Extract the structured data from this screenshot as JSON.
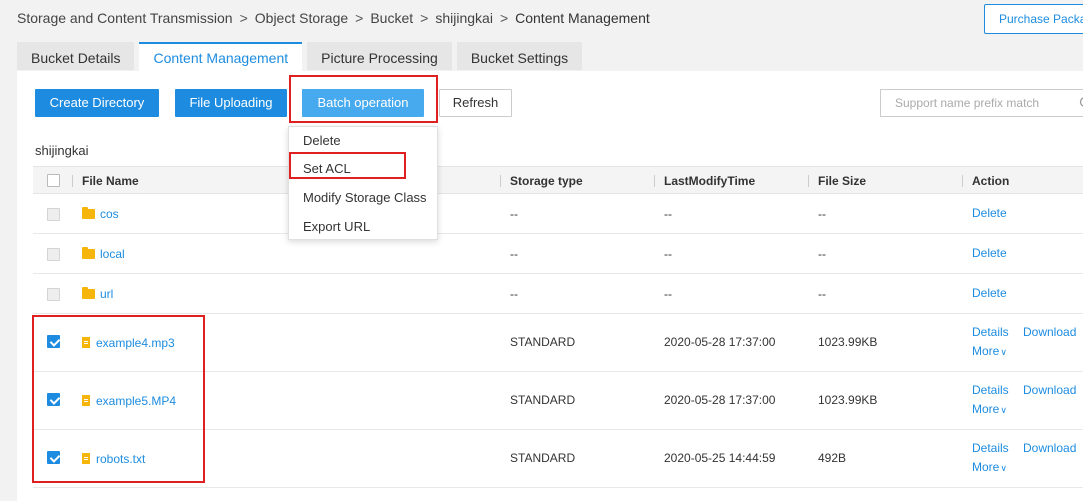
{
  "breadcrumb": {
    "items": [
      "Storage and Content Transmission",
      "Object Storage",
      "Bucket",
      "shijingkai",
      "Content Management"
    ],
    "separator": ">"
  },
  "header": {
    "purchase_label": "Purchase Package"
  },
  "tabs": [
    {
      "label": "Bucket Details",
      "active": false
    },
    {
      "label": "Content Management",
      "active": true
    },
    {
      "label": "Picture Processing",
      "active": false
    },
    {
      "label": "Bucket Settings",
      "active": false
    }
  ],
  "toolbar": {
    "create_directory": "Create Directory",
    "file_uploading": "File Uploading",
    "batch_operation": "Batch operation",
    "refresh": "Refresh",
    "search_placeholder": "Support name prefix match"
  },
  "batch_menu": {
    "items": [
      "Delete",
      "Set ACL",
      "Modify Storage Class",
      "Export URL"
    ]
  },
  "current_path": "shijingkai",
  "table": {
    "columns": [
      "File Name",
      "Storage type",
      "LastModifyTime",
      "File Size",
      "Action"
    ],
    "rows": [
      {
        "name": "cos",
        "type": "folder",
        "storage": "--",
        "modified": "--",
        "size": "--",
        "checked": false,
        "actions": [
          "Delete"
        ]
      },
      {
        "name": "local",
        "type": "folder",
        "storage": "--",
        "modified": "--",
        "size": "--",
        "checked": false,
        "actions": [
          "Delete"
        ]
      },
      {
        "name": "url",
        "type": "folder",
        "storage": "--",
        "modified": "--",
        "size": "--",
        "checked": false,
        "actions": [
          "Delete"
        ]
      },
      {
        "name": "example4.mp3",
        "type": "file",
        "storage": "STANDARD",
        "modified": "2020-05-28 17:37:00",
        "size": "1023.99KB",
        "checked": true,
        "actions": [
          "Details",
          "Download",
          "More"
        ]
      },
      {
        "name": "example5.MP4",
        "type": "file",
        "storage": "STANDARD",
        "modified": "2020-05-28 17:37:00",
        "size": "1023.99KB",
        "checked": true,
        "actions": [
          "Details",
          "Download",
          "More"
        ]
      },
      {
        "name": "robots.txt",
        "type": "file",
        "storage": "STANDARD",
        "modified": "2020-05-25 14:44:59",
        "size": "492B",
        "checked": true,
        "actions": [
          "Details",
          "Download",
          "More"
        ]
      }
    ]
  },
  "colors": {
    "accent": "#1d8ce0",
    "batch_button": "#47a9ee",
    "highlight": "#e02020",
    "folder": "#f5b50a"
  }
}
